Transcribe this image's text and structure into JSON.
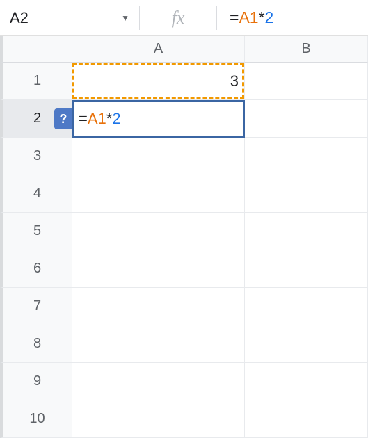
{
  "name_box": {
    "value": "A2"
  },
  "formula_bar": {
    "fx_label": "fx",
    "tokens": {
      "eq": "=",
      "ref": "A1",
      "op": "*",
      "num": "2"
    }
  },
  "columns": [
    {
      "label": "A"
    },
    {
      "label": "B"
    }
  ],
  "rows": [
    {
      "label": "1"
    },
    {
      "label": "2"
    },
    {
      "label": "3"
    },
    {
      "label": "4"
    },
    {
      "label": "5"
    },
    {
      "label": "6"
    },
    {
      "label": "7"
    },
    {
      "label": "8"
    },
    {
      "label": "9"
    },
    {
      "label": "10"
    }
  ],
  "cells": {
    "a1": "3"
  },
  "editor": {
    "help_icon": "?",
    "tokens": {
      "eq": "=",
      "ref": "A1",
      "op": "*",
      "num": "2"
    }
  }
}
